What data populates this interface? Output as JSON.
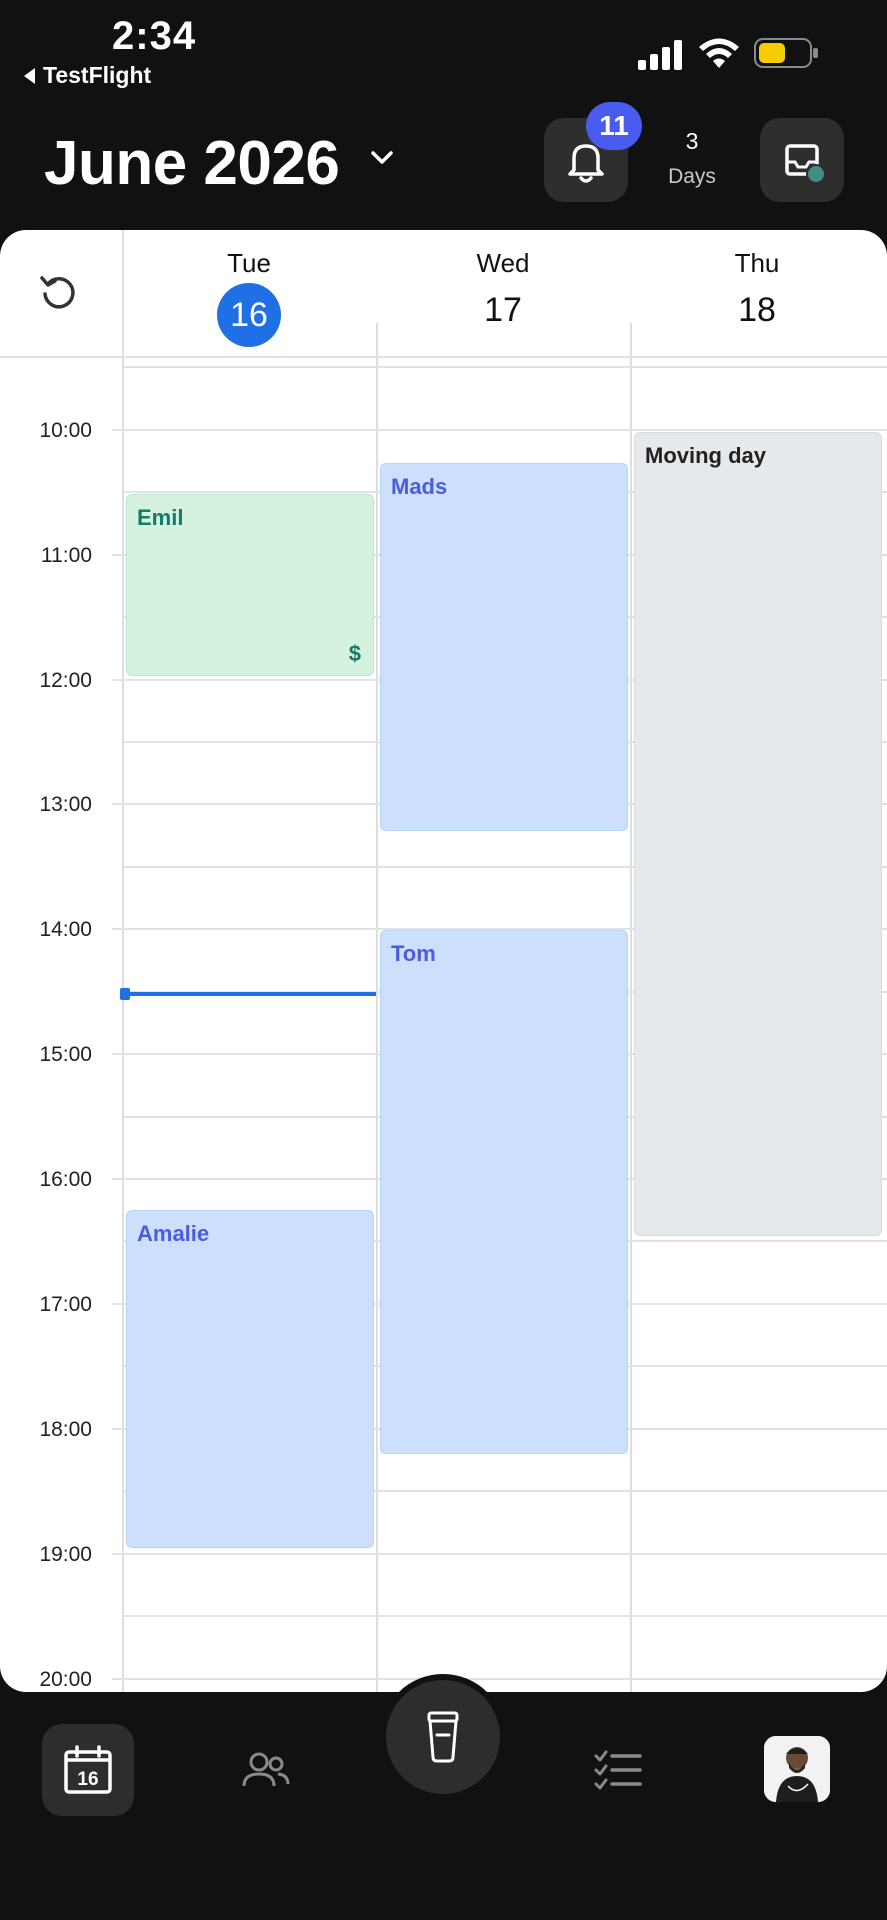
{
  "status_bar": {
    "time": "2:34",
    "back_app": "TestFlight"
  },
  "header": {
    "month_title": "June 2026",
    "notification_count": "11",
    "view_days_number": "3",
    "view_days_label": "Days"
  },
  "calendar": {
    "days": [
      {
        "name": "Tue",
        "date": "16",
        "is_today": true
      },
      {
        "name": "Wed",
        "date": "17",
        "is_today": false
      },
      {
        "name": "Thu",
        "date": "18",
        "is_today": false
      }
    ],
    "hours": [
      "10:00",
      "11:00",
      "12:00",
      "13:00",
      "14:00",
      "15:00",
      "16:00",
      "17:00",
      "18:00",
      "19:00",
      "20:00"
    ],
    "events": [
      {
        "title": "Emil",
        "day": "Tue",
        "start": "10:30",
        "end": "12:00",
        "color": "green",
        "badge": "$"
      },
      {
        "title": "Amalie",
        "day": "Tue",
        "start": "16:15",
        "end": "19:00",
        "color": "blue"
      },
      {
        "title": "Mads",
        "day": "Wed",
        "start": "10:15",
        "end": "13:15",
        "color": "blue"
      },
      {
        "title": "Tom",
        "day": "Wed",
        "start": "14:00",
        "end": "18:15",
        "color": "blue"
      },
      {
        "title": "Moving day",
        "day": "Thu",
        "start": "10:00",
        "end": "16:30",
        "color": "gray"
      }
    ],
    "current_time_indicator": "14:32"
  },
  "colors": {
    "today": "#1f6fe5",
    "badge": "#4a5cf0",
    "event_blue": "#cce0fd",
    "event_green": "#d4f2de",
    "event_gray": "#e6e9ec"
  },
  "bottom_nav": {
    "calendar_icon_date": "16",
    "items": [
      "calendar-icon",
      "clients-icon",
      "center-cup-icon",
      "tasks-icon",
      "profile-avatar"
    ]
  }
}
